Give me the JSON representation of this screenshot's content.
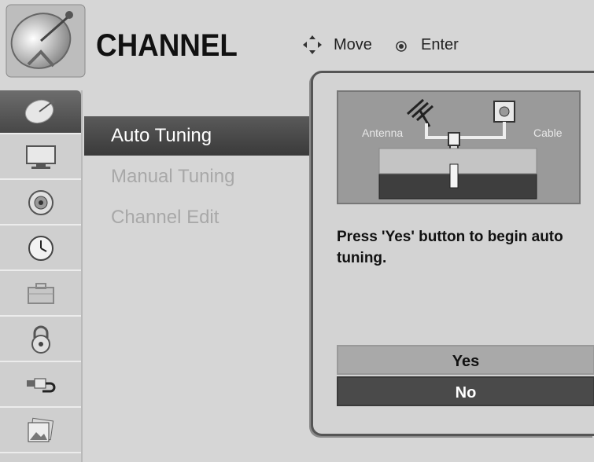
{
  "header": {
    "title": "CHANNEL",
    "logo_icon": "satellite-dish-icon",
    "hints": {
      "move_icon": "four-way-arrow-icon",
      "move_label": "Move",
      "enter_icon": "enter-dot-icon",
      "enter_label": "Enter"
    }
  },
  "sidebar": {
    "items": [
      {
        "icon": "satellite-dish-icon",
        "selected": true
      },
      {
        "icon": "monitor-icon",
        "selected": false
      },
      {
        "icon": "speaker-icon",
        "selected": false
      },
      {
        "icon": "clock-icon",
        "selected": false
      },
      {
        "icon": "toolbox-icon",
        "selected": false
      },
      {
        "icon": "padlock-icon",
        "selected": false
      },
      {
        "icon": "input-plug-icon",
        "selected": false
      },
      {
        "icon": "photo-icon",
        "selected": false
      }
    ]
  },
  "menu": {
    "items": [
      {
        "label": "Auto Tuning",
        "state": "active"
      },
      {
        "label": "Manual Tuning",
        "state": "inactive"
      },
      {
        "label": "Channel Edit",
        "state": "inactive"
      }
    ]
  },
  "popup": {
    "diagram": {
      "antenna_label": "Antenna",
      "cable_label": "Cable"
    },
    "message": "Press 'Yes' button to begin auto tuning.",
    "yes_label": "Yes",
    "no_label": "No"
  },
  "colors": {
    "background": "#d6d6d6",
    "selected": "#474747",
    "inactive_text": "#a8a8a8"
  }
}
